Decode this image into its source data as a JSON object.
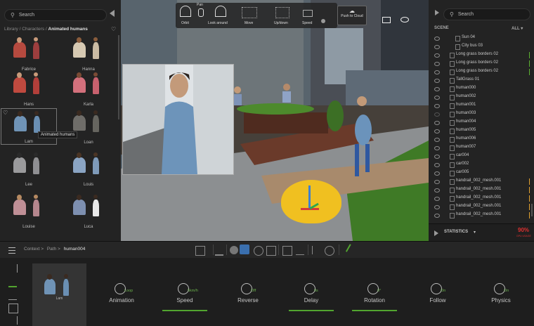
{
  "left_panel": {
    "search_placeholder": "Search",
    "breadcrumb": {
      "library": "Library",
      "characters": "Characters",
      "current": "Animated humans"
    },
    "characters": [
      {
        "name": "Fabrice"
      },
      {
        "name": "Hanna"
      },
      {
        "name": "Hans"
      },
      {
        "name": "Karla"
      },
      {
        "name": "Lam"
      },
      {
        "name": "Loan"
      },
      {
        "name": "Lee"
      },
      {
        "name": "Louis"
      },
      {
        "name": "Louise"
      },
      {
        "name": "Luca"
      }
    ],
    "tooltip": "Animated humans"
  },
  "viewport_toolbar": {
    "pan_label": "Pan",
    "orbit_label": "Orbit",
    "look_around_label": "Look around",
    "move_label": "Move",
    "updown_label": "Up/down",
    "speed_label": "Speed",
    "push_label": "Push to Cloud"
  },
  "right_panel": {
    "search_placeholder": "Search",
    "scene_label": "SCENE",
    "filter_label": "ALL",
    "items": [
      {
        "label": "Sun 04",
        "color": ""
      },
      {
        "label": "City bus 03",
        "color": ""
      },
      {
        "label": "Long grass borders 02",
        "color": "#5cb031"
      },
      {
        "label": "Long grass borders 02",
        "color": "#5cb031"
      },
      {
        "label": "Long grass borders 02",
        "color": "#5cb031"
      },
      {
        "label": "TallGrass 01",
        "color": ""
      },
      {
        "label": "human000",
        "color": ""
      },
      {
        "label": "human002",
        "color": ""
      },
      {
        "label": "human001",
        "color": ""
      },
      {
        "label": "human003",
        "color": ""
      },
      {
        "label": "human004",
        "color": ""
      },
      {
        "label": "human005",
        "color": ""
      },
      {
        "label": "human006",
        "color": ""
      },
      {
        "label": "human007",
        "color": ""
      },
      {
        "label": "car004",
        "color": ""
      },
      {
        "label": "car002",
        "color": ""
      },
      {
        "label": "car005",
        "color": ""
      },
      {
        "label": "handrail_002_mesh.001",
        "color": "#e0a030"
      },
      {
        "label": "handrail_002_mesh.001",
        "color": "#e0a030"
      },
      {
        "label": "handrail_002_mesh.001",
        "color": "#e0a030"
      },
      {
        "label": "handrail_002_mesh.001",
        "color": "#e0a030"
      },
      {
        "label": "handrail_002_mesh.001",
        "color": "#e0a030"
      }
    ],
    "statistics_label": "STATISTICS",
    "gpu_value": "90%",
    "gpu_label": "GPU USAGE"
  },
  "toolbar": {
    "breadcrumb": [
      "Context",
      "Path",
      "human004"
    ]
  },
  "bottom_panel": {
    "selected_name": "Lam",
    "properties": [
      {
        "label": "Animation",
        "value": "Loop",
        "underline": false
      },
      {
        "label": "Speed",
        "value": "5km/h",
        "underline": true
      },
      {
        "label": "Reverse",
        "value": "Off",
        "underline": false
      },
      {
        "label": "Delay",
        "value": "0s",
        "underline": true
      },
      {
        "label": "Rotation",
        "value": "0°",
        "underline": true
      },
      {
        "label": "Follow",
        "value": "On",
        "underline": false
      },
      {
        "label": "Physics",
        "value": "On",
        "underline": false
      }
    ]
  },
  "colors": {
    "accent_green": "#52a52f",
    "accent_blue": "#3d7fd1",
    "gizmo_yellow": "#f0c020",
    "gpu_red": "#e03030"
  }
}
